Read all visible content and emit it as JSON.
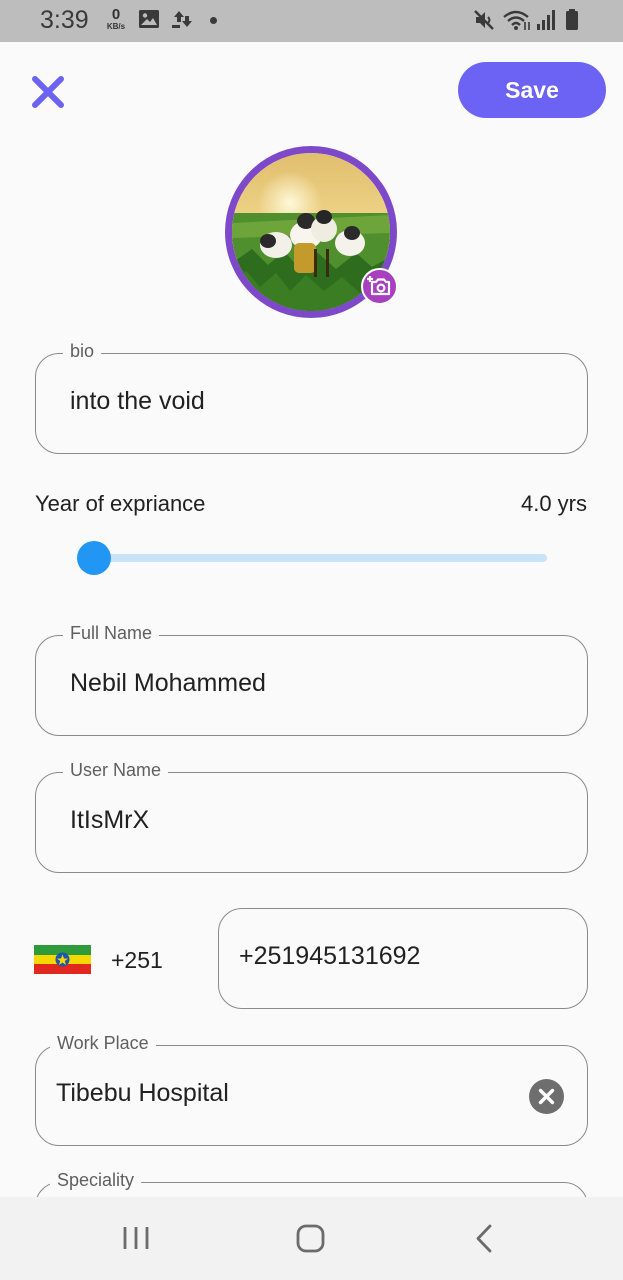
{
  "status_bar": {
    "time": "3:39",
    "net_speed_value": "0",
    "net_speed_unit": "KB/s",
    "icons": [
      "gallery-icon",
      "transfer-icon",
      "dot-icon",
      "mute-icon",
      "wifi-icon",
      "signal-icon",
      "battery-icon"
    ]
  },
  "header": {
    "close_icon": "close-icon",
    "save_label": "Save"
  },
  "avatar": {
    "camera_icon": "add-photo-icon"
  },
  "bio": {
    "label": "bio",
    "value": "into the void"
  },
  "experience": {
    "label": "Year of expriance",
    "value_text": "4.0 yrs",
    "slider_fraction": 0
  },
  "full_name": {
    "label": "Full Name",
    "value": "Nebil Mohammed"
  },
  "user_name": {
    "label": "User Name",
    "value": "ItIsMrX"
  },
  "phone": {
    "country_flag": "ethiopia-flag-icon",
    "dial_code": "+251",
    "value": "+251945131692"
  },
  "work_place": {
    "label": "Work Place",
    "value": "Tibebu Hospital",
    "clear_icon": "clear-icon"
  },
  "speciality": {
    "label": "Speciality"
  },
  "nav_bar": {
    "icons": [
      "recents-icon",
      "home-icon",
      "back-icon"
    ]
  },
  "colors": {
    "accent": "#6c63f5",
    "avatar_ring": "#7e49c9",
    "slider_active": "#2196f3",
    "slider_inactive": "#c8e2f6"
  }
}
